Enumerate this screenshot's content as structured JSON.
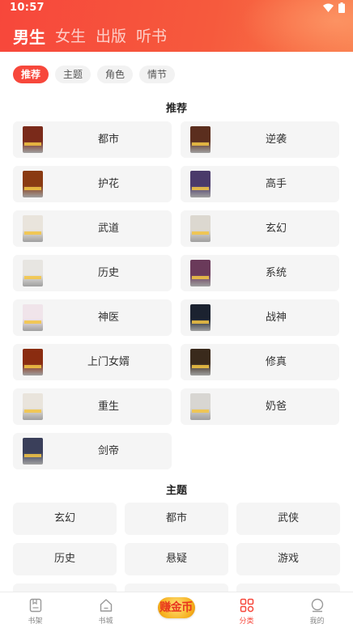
{
  "status_bar": {
    "time": "10:57"
  },
  "gender_tabs": [
    "男生",
    "女生",
    "出版",
    "听书"
  ],
  "filter_chips": [
    "推荐",
    "主题",
    "角色",
    "情节"
  ],
  "recommend": {
    "title": "推荐",
    "items": [
      "都市",
      "逆袭",
      "护花",
      "高手",
      "武道",
      "玄幻",
      "历史",
      "系统",
      "神医",
      "战神",
      "上门女婿",
      "修真",
      "重生",
      "奶爸",
      "剑帝"
    ],
    "cover_colors": [
      "#7a2a1a",
      "#5b2e1e",
      "#8a3a12",
      "#4a3a6a",
      "#e9e4dc",
      "#dcd8d0",
      "#e7e5e1",
      "#6a3a5a",
      "#f0e4ea",
      "#1b2230",
      "#8a2c10",
      "#3a2a1c",
      "#e9e4dc",
      "#d8d6d2",
      "#3a3f5a"
    ]
  },
  "theme": {
    "title": "主题",
    "items": [
      "玄幻",
      "都市",
      "武侠",
      "历史",
      "悬疑",
      "游戏",
      "",
      "",
      ""
    ]
  },
  "bottom_nav": [
    {
      "label": "书架",
      "icon": "bookshelf-icon"
    },
    {
      "label": "书城",
      "icon": "home-icon"
    },
    {
      "label": "赚金币",
      "icon": "earn-coins-badge"
    },
    {
      "label": "分类",
      "icon": "category-icon"
    },
    {
      "label": "我的",
      "icon": "profile-icon"
    }
  ],
  "colors": {
    "accent": "#f7473b",
    "chip_bg": "#f2f2f2",
    "cell_bg": "#f5f5f5"
  }
}
